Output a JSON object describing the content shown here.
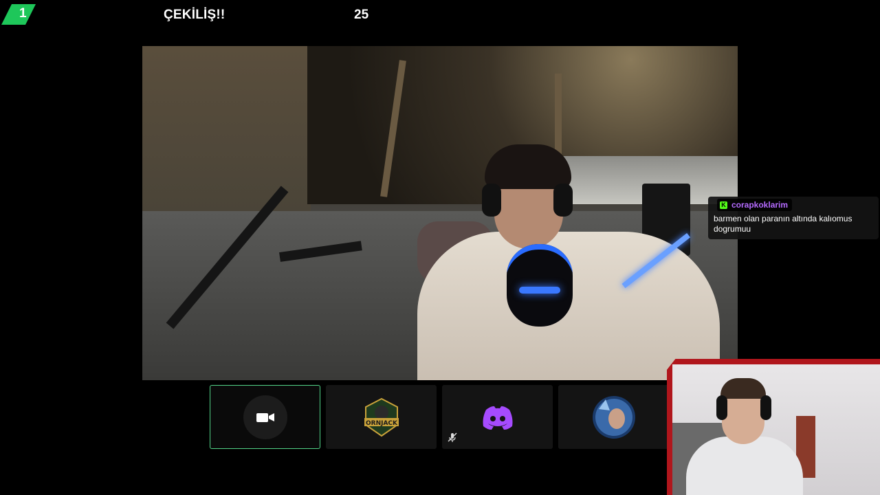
{
  "header": {
    "badge_number": "1",
    "title": "ÇEKİLİŞ!!",
    "count": "25"
  },
  "chat": {
    "username": "corapkoklarim",
    "platform_icon_letter": "K",
    "message": "barmen olan paranın altında kalıomus dogrumuu"
  },
  "participants": [
    {
      "name": "camera-off",
      "active": true,
      "icon": "video-camera-icon"
    },
    {
      "name": "ornjack",
      "active": false,
      "icon": "ornjack-logo"
    },
    {
      "name": "discord",
      "active": false,
      "icon": "discord-icon",
      "muted": true
    },
    {
      "name": "wolf-avatar",
      "active": false,
      "icon": "avatar"
    }
  ],
  "colors": {
    "accent_green": "#1ec75a",
    "active_border": "#53d68a",
    "chat_username": "#b56bff",
    "discord": "#5865f2",
    "webcam_frame": "#b0161c"
  }
}
